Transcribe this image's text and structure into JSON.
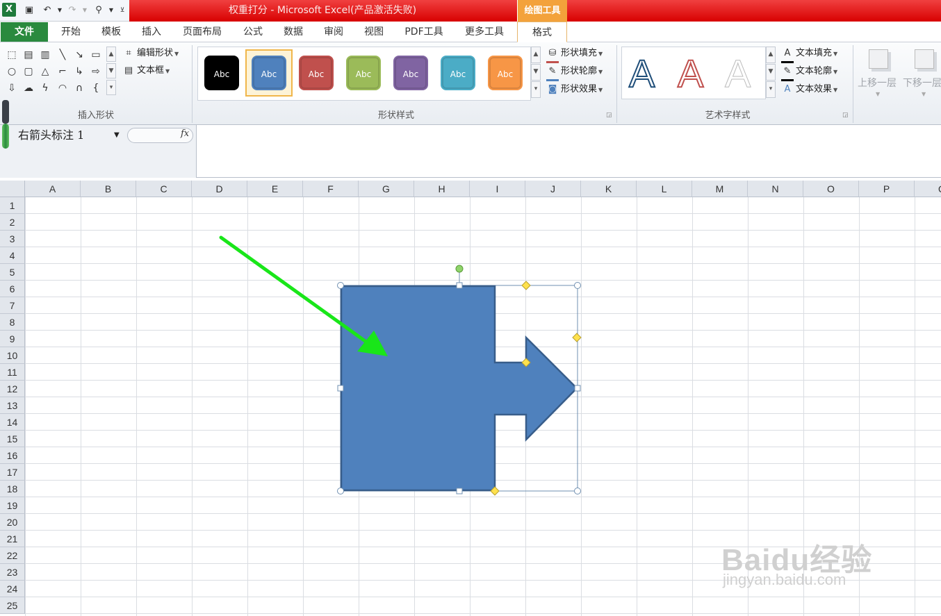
{
  "window": {
    "title": "权重打分 - Microsoft Excel(产品激活失败)",
    "context_tool_label": "绘图工具"
  },
  "tabs": [
    "开始",
    "模板",
    "插入",
    "页面布局",
    "公式",
    "数据",
    "审阅",
    "视图",
    "PDF工具",
    "更多工具"
  ],
  "file_tab": "文件",
  "format_tab": "格式",
  "ribbon": {
    "insert_shapes": {
      "label": "插入形状",
      "edit_shape": "编辑形状",
      "text_box": "文本框"
    },
    "shape_styles": {
      "label": "形状样式",
      "swatch_text": "Abc",
      "swatches": [
        "#000000",
        "#4f81bd",
        "#c0504d",
        "#9bbb59",
        "#8064a2",
        "#4bacc6",
        "#f79646"
      ],
      "fill": "形状填充",
      "outline": "形状轮廓",
      "effects": "形状效果"
    },
    "wordart": {
      "label": "艺术字样式",
      "glyph": "A",
      "fill": "文本填充",
      "outline": "文本轮廓",
      "effects": "文本效果"
    },
    "arrange": {
      "bring_forward": "上移一层",
      "send_backward": "下移一层"
    }
  },
  "formula_bar": {
    "name_box": "右箭头标注 1",
    "fx": "fx"
  },
  "sheet": {
    "columns": [
      "A",
      "B",
      "C",
      "D",
      "E",
      "F",
      "G",
      "H",
      "I",
      "J",
      "K",
      "L",
      "M",
      "N",
      "O",
      "P",
      "Q"
    ],
    "rows": [
      "1",
      "2",
      "3",
      "4",
      "5",
      "6",
      "7",
      "8",
      "9",
      "10",
      "11",
      "12",
      "13",
      "14",
      "15",
      "16",
      "17",
      "18",
      "19",
      "20",
      "21",
      "22",
      "23",
      "24",
      "25"
    ]
  },
  "shape": {
    "name": "right-arrow-callout",
    "fill": "#4f81bd",
    "outline": "#385d8a",
    "annotation_color": "#19e619"
  },
  "watermark": {
    "logo": "Baidu经验",
    "url": "jingyan.baidu.com"
  }
}
